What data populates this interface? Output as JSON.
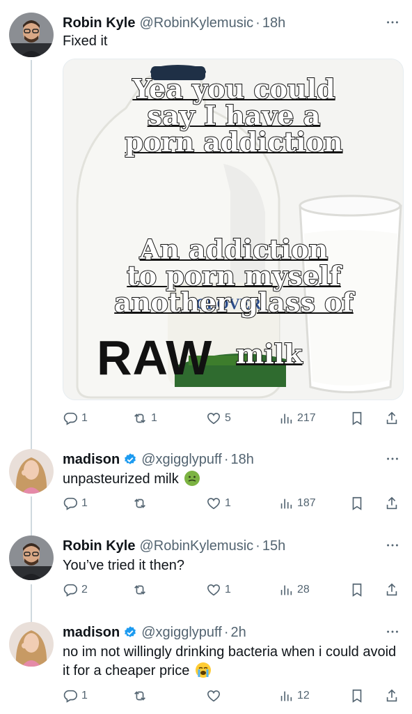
{
  "tweets": [
    {
      "name": "Robin Kyle",
      "handle": "@RobinKylemusic",
      "time": "18h",
      "text": "Fixed it",
      "verified": false,
      "stats": {
        "replies": "1",
        "reposts": "1",
        "likes": "5",
        "views": "217"
      }
    },
    {
      "name": "madison",
      "handle": "@xgigglypuff",
      "time": "18h",
      "text": "unpasteurized milk",
      "emoji": "nauseated-face-icon",
      "verified": true,
      "stats": {
        "replies": "1",
        "reposts": "",
        "likes": "1",
        "views": "187"
      }
    },
    {
      "name": "Robin Kyle",
      "handle": "@RobinKylemusic",
      "time": "15h",
      "text": "You’ve tried it then?",
      "verified": false,
      "stats": {
        "replies": "2",
        "reposts": "",
        "likes": "1",
        "views": "28"
      }
    },
    {
      "name": "madison",
      "handle": "@xgigglypuff",
      "time": "2h",
      "text": "no im not willingly drinking bacteria when i could avoid it for a cheaper price",
      "emoji": "loudly-crying-face-icon",
      "verified": true,
      "stats": {
        "replies": "1",
        "reposts": "",
        "likes": "",
        "views": "12"
      }
    }
  ],
  "meme": {
    "top_lines": [
      "Yea you could",
      "say I have a",
      "porn addiction"
    ],
    "bottom_lines": [
      "An addiction",
      "to porn myself",
      "another glass of"
    ],
    "raw": "RAW",
    "milk": "milk",
    "jug_brand": "CLOVER"
  },
  "colors": {
    "accent": "#1d9bf0",
    "muted": "#536471",
    "text": "#0f1419",
    "line": "#cfd9de"
  }
}
